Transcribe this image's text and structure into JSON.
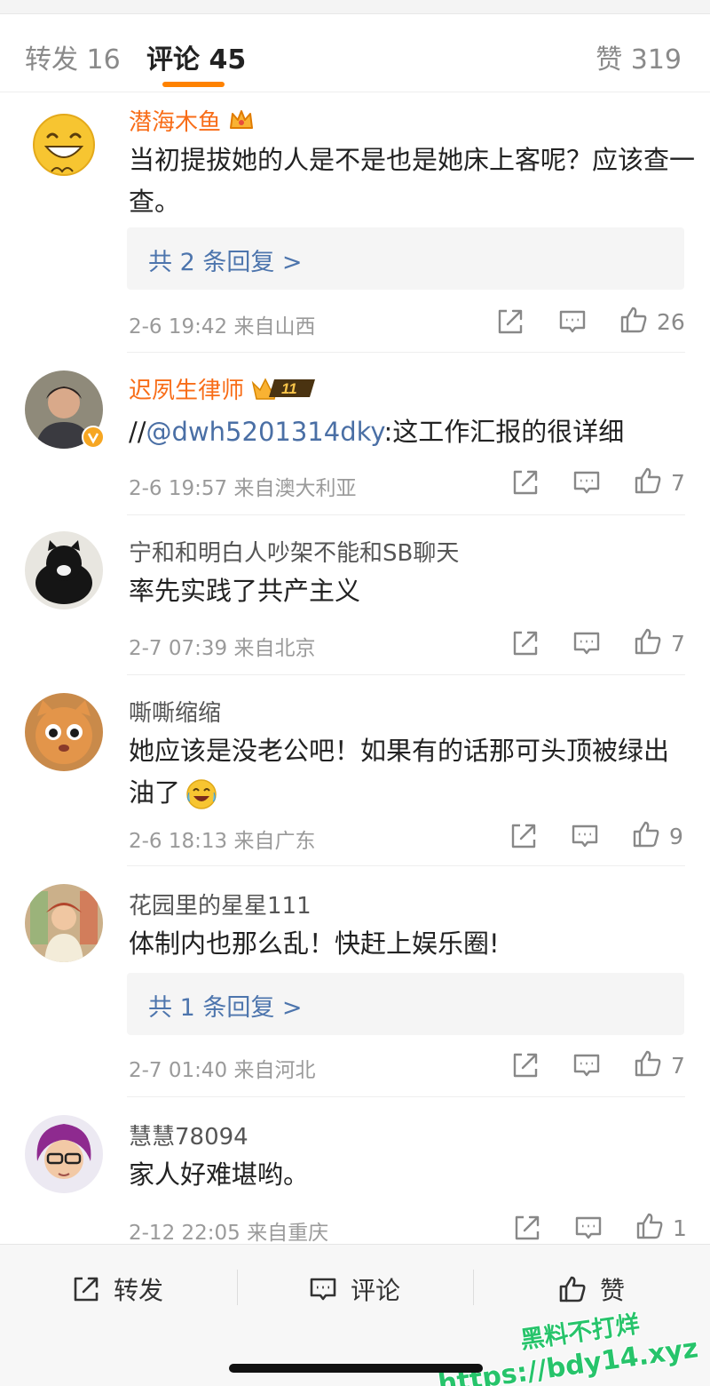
{
  "tabs": {
    "repost": "转发 16",
    "comments": "评论 45",
    "likes": "赞 319"
  },
  "comments": [
    {
      "user": "潜海木鱼",
      "text": "当初提拔她的人是不是也是她床上客呢？应该查一查。",
      "replies": "共 2 条回复 >",
      "time": "2-6 19:42",
      "location": "来自山西",
      "likes": "26"
    },
    {
      "user": "迟夙生律师",
      "text_prefix": "//",
      "mention": "@dwh5201314dky",
      "text": ":这工作汇报的很详细",
      "time": "2-6 19:57",
      "location": "来自澳大利亚",
      "likes": "7",
      "badge_level": "11"
    },
    {
      "user": "宁和和明白人吵架不能和SB聊天",
      "text": "率先实践了共产主义",
      "time": "2-7 07:39",
      "location": "来自北京",
      "likes": "7"
    },
    {
      "user": "嘶嘶缩缩",
      "text": "她应该是没老公吧！如果有的话那可头顶被绿出油了",
      "time": "2-6 18:13",
      "location": "来自广东",
      "likes": "9"
    },
    {
      "user": "花园里的星星111",
      "text": "体制内也那么乱！快赶上娱乐圈!",
      "replies": "共 1 条回复 >",
      "time": "2-7 01:40",
      "location": "来自河北",
      "likes": "7"
    },
    {
      "user": "慧慧78094",
      "text": "家人好难堪哟。",
      "time": "2-12 22:05",
      "location": "来自重庆",
      "likes": "1"
    }
  ],
  "bottombar": {
    "repost": "转发",
    "comment": "评论",
    "like": "赞"
  },
  "watermark": {
    "line1": "黑料不打烊",
    "line2": "https://bdy14.xyz"
  },
  "colors": {
    "accent": "#ff8200",
    "vip_name": "#f86d18",
    "link": "#4d75ad",
    "watermark": "#27c46b"
  },
  "icons": [
    "repost-icon",
    "comment-icon",
    "like-icon",
    "crown-icon",
    "vip-level-badge",
    "laughing-crying-emoji"
  ]
}
